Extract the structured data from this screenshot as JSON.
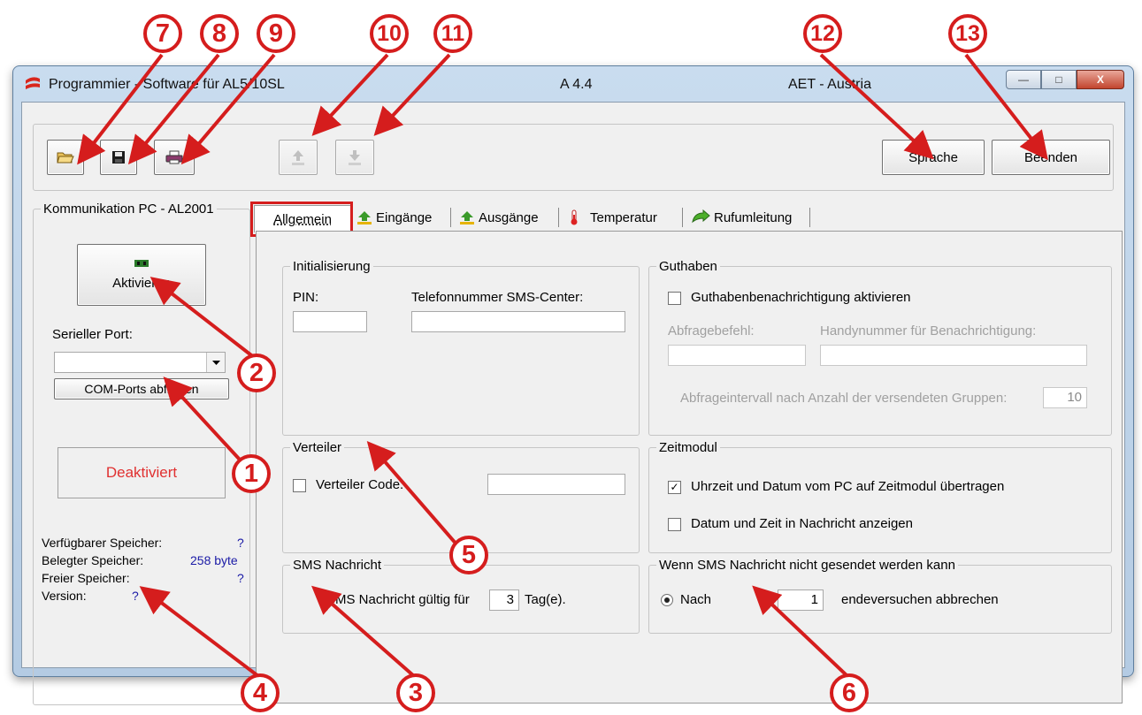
{
  "window": {
    "title": "Programmier - Software für AL5/10SL",
    "version": "A 4.4",
    "company": "AET - Austria"
  },
  "toolbar": {
    "open_icon": "open-folder-icon",
    "save_icon": "floppy-save-icon",
    "print_icon": "printer-icon",
    "upload_icon": "upload-icon",
    "download_icon": "download-icon",
    "sprache_label": "Sprache",
    "beenden_label": "Beenden"
  },
  "left_panel": {
    "group_title": "Kommunikation PC - AL2001",
    "aktivieren_label": "Aktivieren",
    "serial_port_label": "Serieller Port:",
    "serial_port_value": "",
    "com_ports_button": "COM-Ports abfragen",
    "status_label": "Deaktiviert",
    "status_color": "#e03030",
    "memory": {
      "available_label": "Verfügbarer Speicher:",
      "available_value": "?",
      "used_label": "Belegter Speicher:",
      "used_value": "258 byte",
      "free_label": "Freier Speicher:",
      "free_value": "?",
      "version_label": "Version:",
      "version_value": "?"
    }
  },
  "tabs": [
    {
      "label": "Allgemein",
      "icon": "none",
      "active": true
    },
    {
      "label": "Eingänge",
      "icon": "input-icon"
    },
    {
      "label": "Ausgänge",
      "icon": "output-icon"
    },
    {
      "label": "Temperatur",
      "icon": "thermometer-icon"
    },
    {
      "label": "Rufumleitung",
      "icon": "call-forward-icon"
    }
  ],
  "initialisierung": {
    "title": "Initialisierung",
    "pin_label": "PIN:",
    "pin_value": "",
    "sms_center_label": "Telefonnummer SMS-Center:",
    "sms_center_value": ""
  },
  "guthaben": {
    "title": "Guthaben",
    "notify_label": "Guthabenbenachrichtigung aktivieren",
    "notify_checked": false,
    "query_cmd_label": "Abfragebefehl:",
    "handy_label": "Handynummer für Benachrichtigung:",
    "interval_label": "Abfrageintervall nach Anzahl der versendeten Gruppen:",
    "interval_value": "10"
  },
  "verteiler": {
    "title": "Verteiler",
    "code_label": "Verteiler Code:",
    "code_checked": false,
    "code_value": ""
  },
  "zeitmodul": {
    "title": "Zeitmodul",
    "transfer_label": "Uhrzeit und Datum vom PC auf Zeitmodul übertragen",
    "transfer_checked": true,
    "show_label": "Datum und Zeit in Nachricht anzeigen",
    "show_checked": false
  },
  "sms_nachricht": {
    "title": "SMS Nachricht",
    "valid_label": "SMS Nachricht gültig für",
    "valid_value": "3",
    "unit_label": "Tag(e)."
  },
  "send_fail": {
    "title": "Wenn SMS Nachricht nicht gesendet werden kann",
    "nach_label": "Nach",
    "attempts_value": "1",
    "suffix_label": "endeversuchen abbrechen"
  },
  "annotations": [
    "1",
    "2",
    "3",
    "4",
    "5",
    "6",
    "7",
    "8",
    "9",
    "10",
    "11",
    "12",
    "13"
  ],
  "colors": {
    "annotation": "#d51d1d"
  }
}
